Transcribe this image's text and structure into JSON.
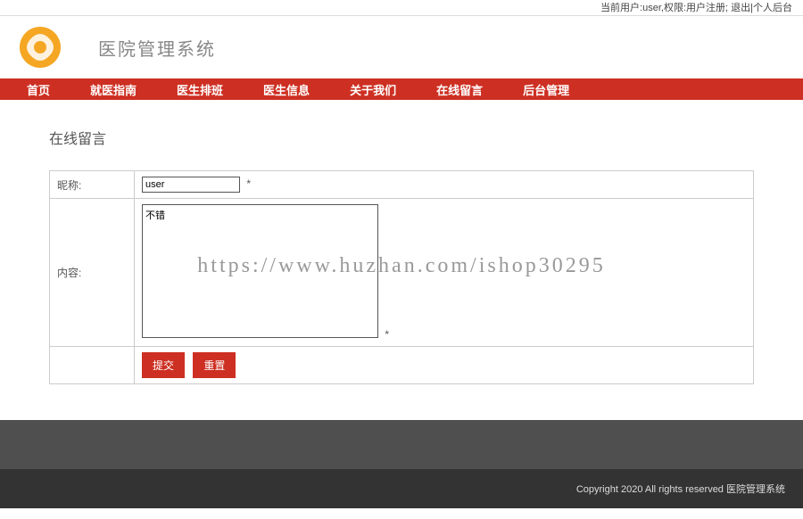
{
  "topbar": {
    "user_label": "当前用户:",
    "user": "user",
    "role_label": ",权限:",
    "role": "用户注册",
    "logout": "退出",
    "profile": "个人后台",
    "separator": "; "
  },
  "header": {
    "site_title": "医院管理系统"
  },
  "nav": {
    "items": [
      {
        "label": "首页"
      },
      {
        "label": "就医指南"
      },
      {
        "label": "医生排班"
      },
      {
        "label": "医生信息"
      },
      {
        "label": "关于我们"
      },
      {
        "label": "在线留言"
      },
      {
        "label": "后台管理"
      }
    ]
  },
  "page": {
    "title": "在线留言"
  },
  "form": {
    "nickname_label": "昵称:",
    "nickname_value": "user",
    "content_label": "内容:",
    "content_value": "不错",
    "required_mark": "*",
    "submit": "提交",
    "reset": "重置"
  },
  "footer": {
    "text": "Copyright 2020 All rights reserved 医院管理系统"
  },
  "watermark": "https://www.huzhan.com/ishop30295"
}
